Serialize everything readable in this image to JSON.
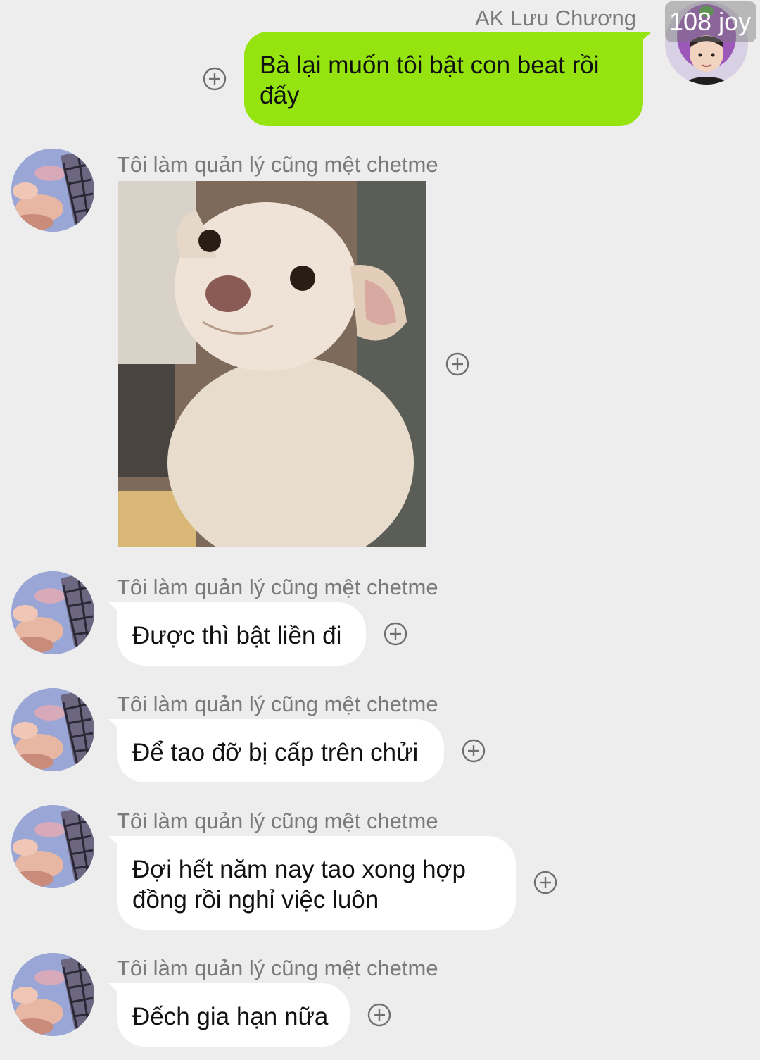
{
  "outgoing": {
    "sender_name": "AK Lưu Chương",
    "badge": "108 joy",
    "text": "Bà lại muốn tôi bật con beat rồi đấy"
  },
  "incoming": [
    {
      "sender_name": "Tôi làm quản lý cũng mệt chetme",
      "kind": "image"
    },
    {
      "sender_name": "Tôi làm quản lý cũng mệt chetme",
      "text": "Được thì bật liền đi"
    },
    {
      "sender_name": "Tôi làm quản lý cũng mệt chetme",
      "text": "Để tao đỡ bị cấp trên chửi"
    },
    {
      "sender_name": "Tôi làm quản lý cũng mệt chetme",
      "text": "Đợi hết năm nay tao xong hợp đồng rồi nghỉ việc luôn"
    },
    {
      "sender_name": "Tôi làm quản lý cũng mệt chetme",
      "text": "Đếch gia hạn nữa"
    }
  ],
  "colors": {
    "background": "#ededed",
    "outgoing_bubble": "#95e40f",
    "incoming_bubble": "#ffffff",
    "name_text": "#7a7a7a"
  },
  "icons": {
    "react": "add-reaction-icon",
    "sticker": "chihuahua-meme-sticker"
  }
}
